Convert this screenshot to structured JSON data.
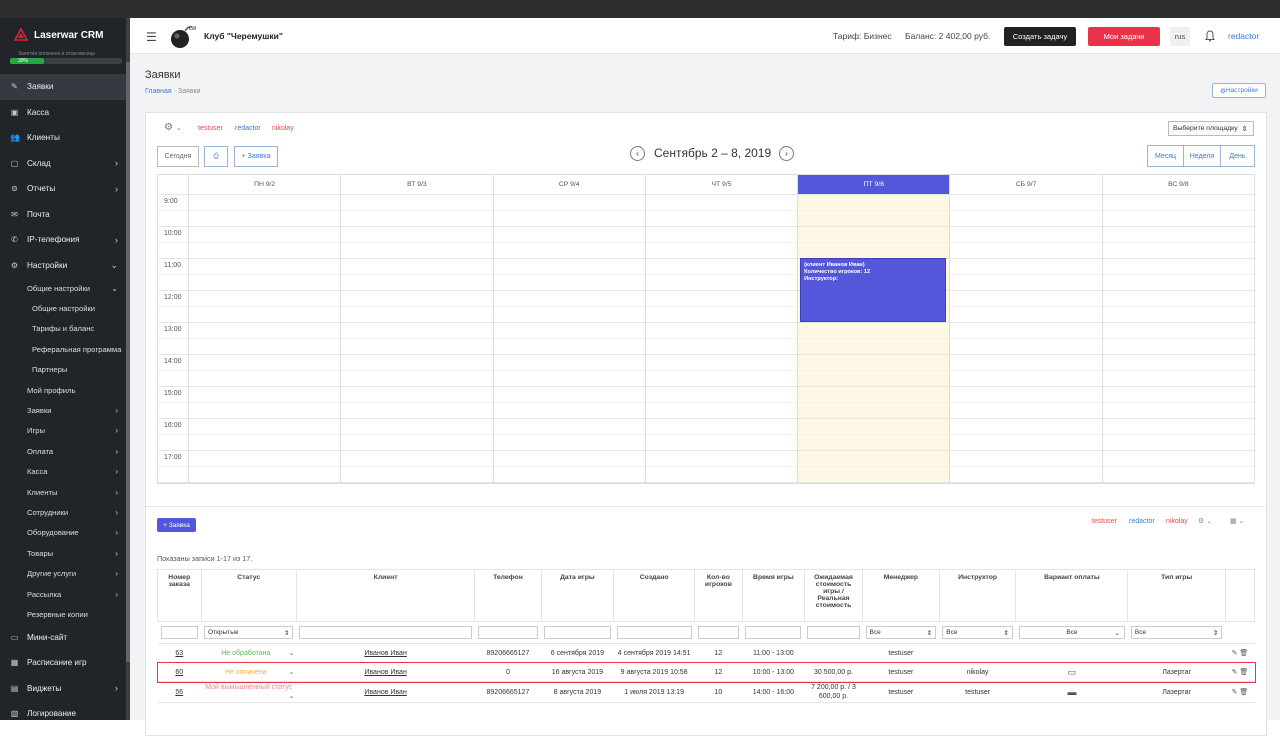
{
  "app": {
    "brand": "Laserwar CRM",
    "brand_sub": "Занятия оплачено в этом месяце",
    "progress_label": "30%",
    "progress_percent": 30
  },
  "sidebar": {
    "items": [
      {
        "label": "Заявки",
        "icon": "edit-icon",
        "chevron": false,
        "active": true
      },
      {
        "label": "Касса",
        "icon": "cash-icon",
        "chevron": false
      },
      {
        "label": "Клиенты",
        "icon": "users-icon",
        "chevron": false
      },
      {
        "label": "Склад",
        "icon": "box-icon",
        "chevron": true
      },
      {
        "label": "Отчеты",
        "icon": "chart-icon",
        "chevron": true
      },
      {
        "label": "Почта",
        "icon": "mail-icon",
        "chevron": false
      },
      {
        "label": "IP-телефония",
        "icon": "phone-icon",
        "chevron": true
      },
      {
        "label": "Настройки",
        "icon": "gear-icon",
        "chevron": true
      }
    ],
    "sub_items": [
      {
        "label": "Общие настройки",
        "level": 1,
        "chevron": true
      },
      {
        "label": "Общие настройки",
        "level": 2
      },
      {
        "label": "Тарифы и баланс",
        "level": 2
      },
      {
        "label": "Реферальная программа",
        "level": 2
      },
      {
        "label": "Партнеры",
        "level": 2
      },
      {
        "label": "Мой профиль",
        "level": 1
      },
      {
        "label": "Заявки",
        "level": 1,
        "chevron": true
      },
      {
        "label": "Игры",
        "level": 1,
        "chevron": true
      },
      {
        "label": "Оплата",
        "level": 1,
        "chevron": true
      },
      {
        "label": "Касса",
        "level": 1,
        "chevron": true
      },
      {
        "label": "Клиенты",
        "level": 1,
        "chevron": true
      },
      {
        "label": "Сотрудники",
        "level": 1,
        "chevron": true
      },
      {
        "label": "Оборудование",
        "level": 1,
        "chevron": true
      },
      {
        "label": "Товары",
        "level": 1,
        "chevron": true
      },
      {
        "label": "Другие услуги",
        "level": 1,
        "chevron": true
      },
      {
        "label": "Рассылка",
        "level": 1,
        "chevron": true
      },
      {
        "label": "Резервные копии",
        "level": 1
      }
    ],
    "bottom_items": [
      {
        "label": "Мини-сайт",
        "icon": "monitor-icon",
        "chevron": false
      },
      {
        "label": "Расписание игр",
        "icon": "calendar-icon",
        "chevron": false
      },
      {
        "label": "Виджеты",
        "icon": "widget-icon",
        "chevron": true
      },
      {
        "label": "Логирование",
        "icon": "log-icon",
        "chevron": false
      }
    ]
  },
  "header": {
    "club": "Клуб \"Черемушки\"",
    "tariff": "Тариф: Бизнес",
    "balance": "Баланс: 2 402,00 руб.",
    "create_task": "Создать задачу",
    "my_tasks": "Мои задачи",
    "lang": "rus",
    "user": "redactor"
  },
  "page": {
    "title": "Заявки",
    "crumb_home": "Главная",
    "crumb_sep": "·",
    "crumb_current": "Заявки",
    "settings_btn": "Настройки"
  },
  "calendar": {
    "users": [
      "testuser",
      "redactor",
      "nikolay"
    ],
    "place_select": "Выберите площадку",
    "today_btn": "Сегодня",
    "add_btn": "+ Заявка",
    "title": "Сентябрь 2 – 8, 2019",
    "views": [
      "Месяц",
      "Неделя",
      "День"
    ],
    "days": [
      "ПН 9/2",
      "ВТ 9/3",
      "СР 9/4",
      "ЧТ 9/5",
      "ПТ 9/6",
      "СБ 9/7",
      "ВС 9/8"
    ],
    "today_index": 4,
    "hours": [
      "9:00",
      "10:00",
      "11:00",
      "12:00",
      "13:00",
      "14:00",
      "15:00",
      "16:00",
      "17:00"
    ],
    "event": {
      "line1": "(клиент Иванов Иван)",
      "line2": "Количество игроков: 12",
      "line3": "Инструктор:",
      "day_index": 4,
      "start": "11:00",
      "end": "13:00"
    }
  },
  "table": {
    "add_btn": "+ Заявка",
    "shown": "Показаны записи 1-17 из 17.",
    "users": [
      "testuser",
      "redactor",
      "nikolay"
    ],
    "headers": [
      "Номер заказа",
      "Статус",
      "Клиент",
      "Телефон",
      "Дата игры",
      "Создано",
      "Кол-во игроков",
      "Время игры",
      "Ожидаемая стоимость игры / Реальная стоимость",
      "Менеджер",
      "Инструктор",
      "Вариант оплаты",
      "Тип игры"
    ],
    "filters": {
      "status": "Открытые",
      "manager": "Все",
      "instructor": "Все",
      "payment": "Все",
      "type": "Все"
    },
    "rows": [
      {
        "id": "63",
        "status": "Не обработана",
        "status_color": "#5cb85c",
        "client": "Иванов Иван",
        "phone": "89206665127",
        "date": "6 сентября 2019",
        "created": "4 сентября 2019 14:51",
        "players": "12",
        "time": "11:00 - 13:00",
        "price": "",
        "manager": "testuser",
        "instructor": "",
        "payment": "",
        "type": ""
      },
      {
        "id": "60",
        "status": "Не оплачена",
        "status_color": "#f0ad4e",
        "client": "Иванов Иван",
        "phone": "0",
        "date": "16 августа 2019",
        "created": "9 августа 2019 10:58",
        "players": "12",
        "time": "10:00 - 13:00",
        "price": "30 500,00 р.",
        "manager": "testuser",
        "instructor": "nikolay",
        "payment": "card-icon",
        "type": "Лазертаг"
      },
      {
        "id": "56",
        "status": "Мой вымышленный статус",
        "status_color": "#f08a8a",
        "client": "Иванов Иван",
        "phone": "89206665127",
        "date": "8 августа 2019",
        "created": "1 июля 2019 13:19",
        "players": "10",
        "time": "14:00 - 16:00",
        "price": "7 200,00 р. / 3 600,00 р.",
        "manager": "testuser",
        "instructor": "testuser",
        "payment": "cash-icon",
        "type": "Лазертаг"
      }
    ]
  },
  "colors": {
    "accent": "#5457d9",
    "danger": "#e8334a",
    "link": "#3c7bd6",
    "sidebar": "#212529"
  }
}
